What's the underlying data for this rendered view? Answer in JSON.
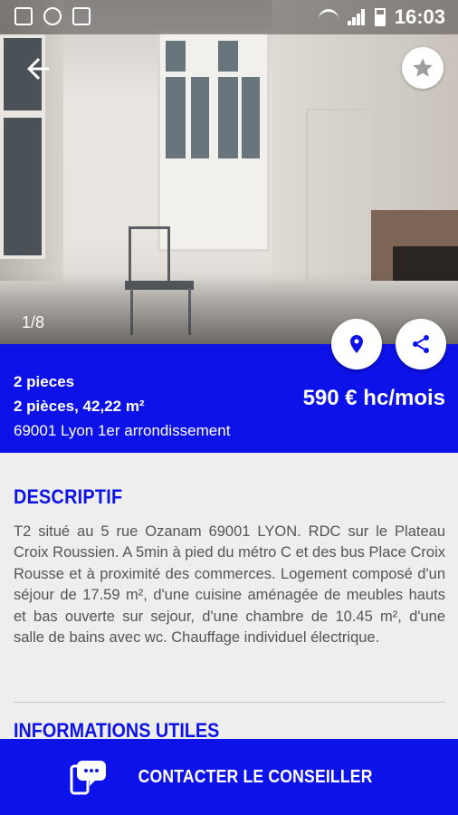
{
  "status_bar": {
    "time": "16:03"
  },
  "gallery": {
    "counter": "1/8"
  },
  "listing": {
    "title": "2 pieces",
    "subtitle": "2 pièces, 42,22 m²",
    "address": "69001 Lyon 1er arrondissement",
    "price": "590 € hc/mois"
  },
  "description": {
    "heading": "DESCRIPTIF",
    "text": "T2 situé au 5 rue Ozanam 69001 LYON. RDC sur le Plateau Croix Roussien. A 5min à pied du métro C et des bus Place Croix Rousse et à proximité des commerces. Logement composé d'un séjour de 17.59 m², d'une cuisine aménagée de meubles hauts et bas ouverte sur sejour, d'une chambre de 10.45 m², d'une salle de bains avec wc. Chauffage individuel électrique."
  },
  "info": {
    "heading": "INFORMATIONS UTILES"
  },
  "cta": {
    "label": "CONTACTER LE CONSEILLER"
  },
  "colors": {
    "primary": "#0d12e8",
    "background": "#eeeeee"
  },
  "icons": [
    "back-arrow-icon",
    "star-icon",
    "location-pin-icon",
    "share-icon",
    "chat-phone-icon"
  ]
}
